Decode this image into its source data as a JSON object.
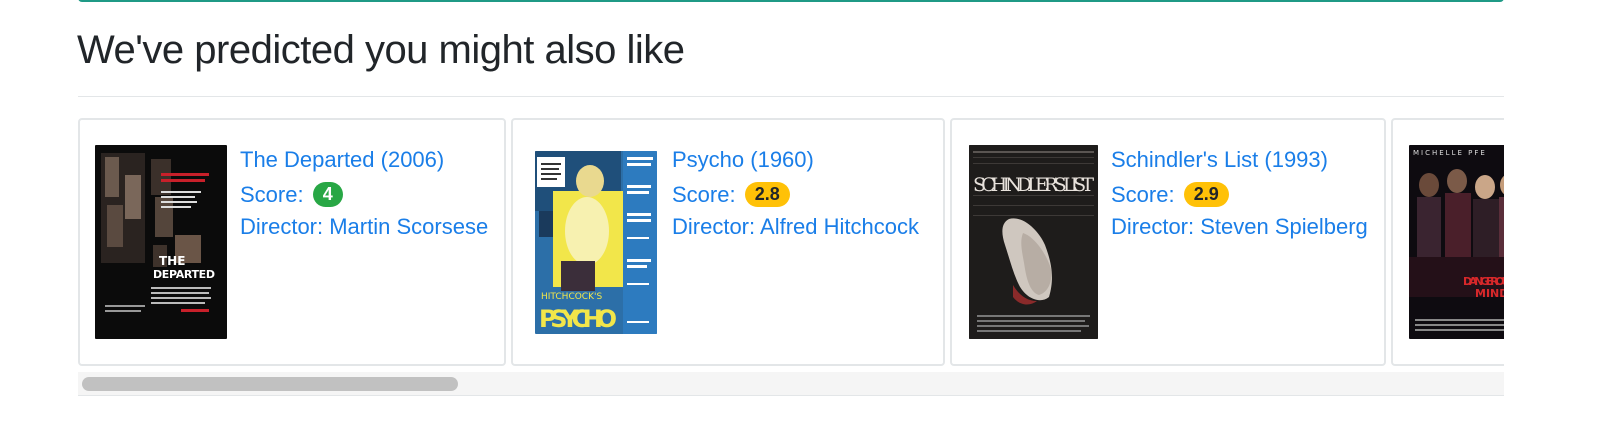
{
  "section": {
    "title": "We've predicted you might also like"
  },
  "colors": {
    "accent_bar": "#1f9a86",
    "link": "#1a7ee8",
    "badge_green": "#28a745",
    "badge_yellow": "#ffc107"
  },
  "movies": [
    {
      "title": "The Departed (2006)",
      "score_label": "Score:",
      "score": "4",
      "director": "Director: Martin Scorsese",
      "badge_color": "green",
      "poster_text": "THE DEPARTED"
    },
    {
      "title": "Psycho (1960)",
      "score_label": "Score:",
      "score": "2.8",
      "director": "Director: Alfred Hitchcock",
      "badge_color": "yellow",
      "poster_text": "PSYCHO"
    },
    {
      "title": "Schindler's List (1993)",
      "score_label": "Score:",
      "score": "2.9",
      "director": "Director: Steven Spielberg",
      "badge_color": "yellow",
      "poster_text": "SCHINDLER'S LIST"
    },
    {
      "poster_text": "DANGEROUS MINDS",
      "poster_top_text": "MICHELLE PFE"
    }
  ]
}
